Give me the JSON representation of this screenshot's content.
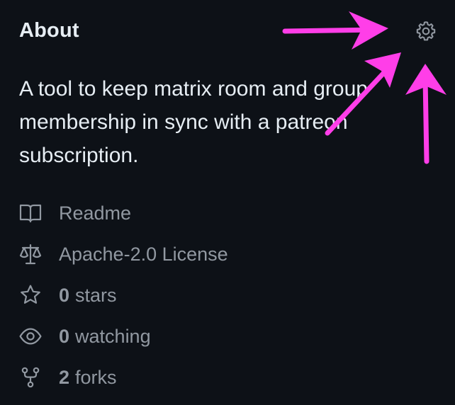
{
  "about": {
    "title": "About",
    "settings_icon": "gear-icon",
    "description": "A tool to keep matrix room and group membership in sync with a patreon subscription."
  },
  "meta": {
    "readme": {
      "icon": "book-icon",
      "label": "Readme"
    },
    "license": {
      "icon": "law-icon",
      "label": "Apache-2.0 License"
    },
    "stars": {
      "icon": "star-icon",
      "count": "0",
      "label": "stars"
    },
    "watching": {
      "icon": "eye-icon",
      "count": "0",
      "label": "watching"
    },
    "forks": {
      "icon": "repo-forked-icon",
      "count": "2",
      "label": "forks"
    }
  },
  "colors": {
    "background": "#0d1117",
    "text_primary": "#e6edf3",
    "text_muted": "#9198a1",
    "annotation_arrows": "#ff3ee8"
  }
}
